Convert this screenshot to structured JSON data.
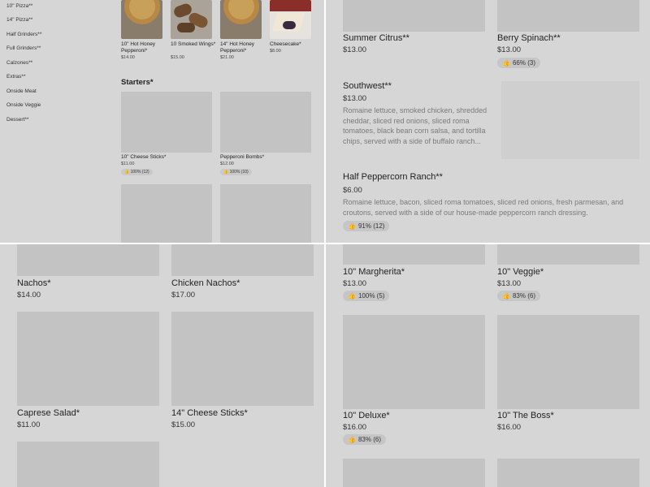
{
  "sidebar": {
    "items": [
      "10\" Pizza**",
      "14\" Pizza**",
      "Half Grinders**",
      "Full Grinders**",
      "Calzones**",
      "Extras**",
      "Onside Meat",
      "Onside Veggie",
      "Dessert**"
    ]
  },
  "top_items": [
    {
      "name": "10\" Hot Honey Pepperoni*",
      "price": "$14.00"
    },
    {
      "name": "10 Smoked Wings*",
      "price": "$15.00"
    },
    {
      "name": "14\" Hot Honey Pepperoni*",
      "price": "$21.00"
    },
    {
      "name": "Cheesecake*",
      "price": "$8.00"
    }
  ],
  "starters": {
    "title": "Starters*",
    "items": [
      {
        "name": "10\" Cheese Sticks*",
        "price": "$11.00",
        "rating": "100% (12)"
      },
      {
        "name": "Pepperoni Bombs*",
        "price": "$12.00",
        "rating": "100% (10)"
      }
    ]
  },
  "salads": {
    "items": [
      {
        "name": "Summer Citrus**",
        "price": "$13.00"
      },
      {
        "name": "Berry Spinach**",
        "price": "$13.00",
        "rating": "66% (3)"
      },
      {
        "name": "Southwest**",
        "price": "$13.00",
        "desc": "Romaine lettuce, smoked chicken, shredded cheddar, sliced red onions, sliced roma tomatoes, black bean corn salsa, and tortilla chips, served with a side of buffalo ranch..."
      },
      {
        "name": "Half Peppercorn Ranch**",
        "price": "$6.00",
        "desc": "Romaine lettuce, bacon, sliced roma tomatoes, sliced red onions, fresh parmesan, and croutons, served with a side of our house-made peppercorn ranch dressing.",
        "rating": "91% (12)"
      }
    ]
  },
  "apps": {
    "items": [
      {
        "name": "Nachos*",
        "price": "$14.00"
      },
      {
        "name": "Chicken Nachos*",
        "price": "$17.00"
      },
      {
        "name": "Caprese Salad*",
        "price": "$11.00"
      },
      {
        "name": "14\" Cheese Sticks*",
        "price": "$15.00"
      }
    ]
  },
  "pizzas": {
    "items": [
      {
        "name": "10\" Margherita*",
        "price": "$13.00",
        "rating": "100% (5)"
      },
      {
        "name": "10\" Veggie*",
        "price": "$13.00",
        "rating": "83% (6)"
      },
      {
        "name": "10\" Deluxe*",
        "price": "$16.00",
        "rating": "83% (6)"
      },
      {
        "name": "10\" The Boss*",
        "price": "$16.00"
      }
    ]
  },
  "icons": {
    "thumb": "thumbs-up-icon"
  }
}
